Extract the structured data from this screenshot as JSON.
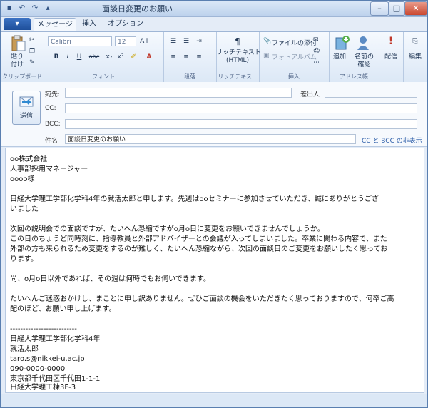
{
  "window": {
    "title": "面談日変更のお願い",
    "controls": {
      "minimize": "–",
      "maximize": "□",
      "close": "✕"
    }
  },
  "quick_access": [
    "▪",
    "↶",
    "↷",
    "▴"
  ],
  "tabs": {
    "file": "▾",
    "message": "メッセージ",
    "insert": "挿入",
    "options": "オプション"
  },
  "ribbon": {
    "paste_label": "貼り\n付け",
    "clipboard_group": "クリップボード",
    "font_name": "Calibri",
    "font_size": "12",
    "font_group": "フォント",
    "font_buttons": [
      "B",
      "I",
      "U",
      "abc",
      "x₂",
      "x²"
    ],
    "paragraph_group": "段落",
    "richtext_label": "リッチテキスト\n(HTML)",
    "richtext_group": "リッチテキス...",
    "attach_file_label": "ファイルの添付",
    "photo_album_label": "フォトアルバム",
    "insert_group": "挿入",
    "add_label": "追加",
    "check_names_label": "名前の\n確認",
    "addressbook_group": "アドレス帳",
    "deliver_label": "配信",
    "edit_label": "編集"
  },
  "headers": {
    "send_label": "送信",
    "to_label": "宛先:",
    "from_label": "差出人",
    "cc_label": "CC:",
    "bcc_label": "BCC:",
    "subject_label": "件名",
    "subject_value": "面談日変更のお願い",
    "cc_bcc_toggle": "CC と BCC の非表示"
  },
  "body_lines": [
    "oo株式会社",
    "人事部採用マネージャー",
    "oooo様",
    "",
    "日経大学理工学部化学科4年の就活太郎と申します。先週はooセミナーに参加させていただき、誠にありがとうござ",
    "いました",
    "",
    "次回の説明会での面談ですが、たいへん恐縮ですがo月o日に変更をお願いできませんでしょうか。",
    "この日のちょうど同時刻に、指導教員と外部アドバイザーとの会議が入ってしまいました。卒業に関わる内容で、また",
    "外部の方も来られるため変更をするのが難しく、たいへん恐縮ながら、次回の面談日のご変更をお願いしたく思ってお",
    "ります。",
    "",
    "尚、o月o日以外であれば、その週は何時でもお伺いできます。",
    "",
    "たいへんご迷惑おかけし、まことに申し訳ありません。ぜひご面談の機会をいただきたく思っておりますので、何卒ご高",
    "配のほど、お願い申し上げます。",
    "",
    "--------------------------",
    "日経大学理工学部化学科4年",
    "就活太郎",
    "taro.s@nikkei-u.ac.jp",
    "090-0000-0000",
    "東京都千代田区千代田1-1-1",
    "日経大学理工棟3F-3"
  ]
}
